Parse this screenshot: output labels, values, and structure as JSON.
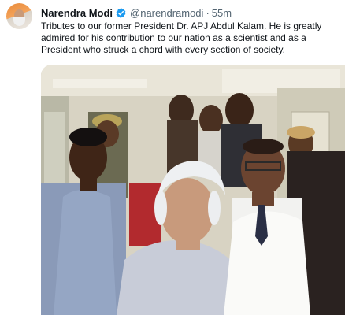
{
  "tweet": {
    "author_name": "Narendra Modi",
    "handle": "@narendramodi",
    "separator": "·",
    "time": "55m",
    "text": "Tributes to our former President Dr. APJ Abdul Kalam. He is greatly admired for his contribution to our nation as a scientist and as a President who struck a chord with every section of society."
  },
  "icons": {
    "verified": "verified-badge-icon"
  },
  "colors": {
    "verified_blue": "#1d9bf0",
    "name_text": "#0f1419",
    "secondary_text": "#536471"
  }
}
